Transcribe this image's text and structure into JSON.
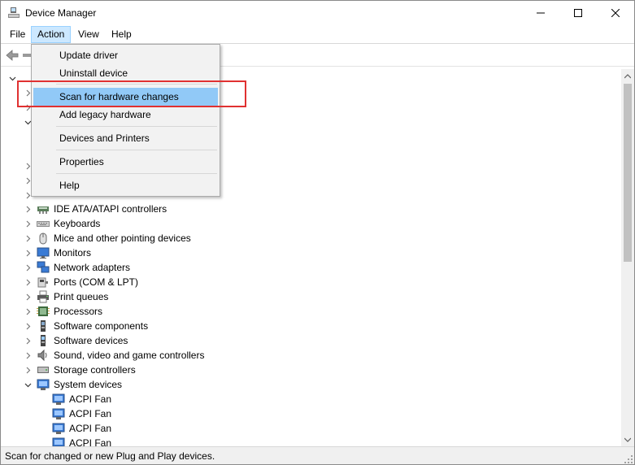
{
  "window": {
    "title": "Device Manager",
    "icon": "device-manager-icon",
    "controls": [
      "minimize-icon",
      "maximize-icon",
      "close-icon"
    ]
  },
  "menubar": {
    "items": [
      "File",
      "Action",
      "View",
      "Help"
    ],
    "active": "Action"
  },
  "toolbar": {
    "icons": [
      "back-arrow-icon",
      "forward-arrow-icon"
    ]
  },
  "action_menu": {
    "items": [
      {
        "label": "Update driver"
      },
      {
        "label": "Uninstall device"
      },
      {
        "label": "Scan for hardware changes",
        "highlighted": true
      },
      {
        "label": "Add legacy hardware"
      },
      {
        "label": "Devices and Printers"
      },
      {
        "label": "Properties"
      },
      {
        "label": "Help"
      }
    ]
  },
  "tree": {
    "categories": [
      {
        "label": "IDE ATA/ATAPI controllers",
        "icon": "ide-controller-icon",
        "expanded": false
      },
      {
        "label": "Keyboards",
        "icon": "keyboard-icon",
        "expanded": false
      },
      {
        "label": "Mice and other pointing devices",
        "icon": "mouse-icon",
        "expanded": false
      },
      {
        "label": "Monitors",
        "icon": "monitor-icon",
        "expanded": false
      },
      {
        "label": "Network adapters",
        "icon": "network-adapter-icon",
        "expanded": false
      },
      {
        "label": "Ports (COM & LPT)",
        "icon": "port-icon",
        "expanded": false
      },
      {
        "label": "Print queues",
        "icon": "printer-icon",
        "expanded": false
      },
      {
        "label": "Processors",
        "icon": "processor-icon",
        "expanded": false
      },
      {
        "label": "Software components",
        "icon": "software-component-icon",
        "expanded": false
      },
      {
        "label": "Software devices",
        "icon": "software-device-icon",
        "expanded": false
      },
      {
        "label": "Sound, video and game controllers",
        "icon": "speaker-icon",
        "expanded": false
      },
      {
        "label": "Storage controllers",
        "icon": "storage-controller-icon",
        "expanded": false
      },
      {
        "label": "System devices",
        "icon": "system-device-icon",
        "expanded": true
      }
    ],
    "children": [
      {
        "label": "ACPI Fan",
        "icon": "system-device-icon"
      },
      {
        "label": "ACPI Fan",
        "icon": "system-device-icon"
      },
      {
        "label": "ACPI Fan",
        "icon": "system-device-icon"
      },
      {
        "label": "ACPI Fan",
        "icon": "system-device-icon"
      }
    ]
  },
  "statusbar": {
    "text": "Scan for changed or new Plug and Play devices."
  },
  "colors": {
    "menu_highlight": "#91c9f7",
    "menubar_active": "#cce8ff",
    "annotation_box": "#e03131"
  }
}
